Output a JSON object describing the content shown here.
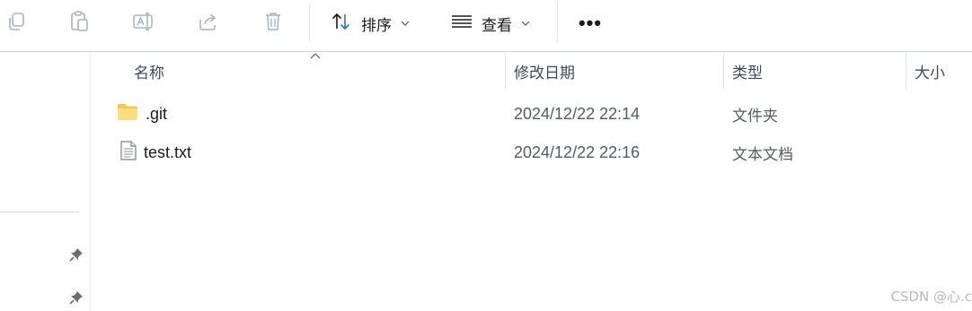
{
  "toolbar": {
    "icons": [
      "copy-icon",
      "paste-icon",
      "rename-icon",
      "share-icon",
      "delete-icon"
    ],
    "sort_label": "排序",
    "view_label": "查看",
    "more_label": "•••"
  },
  "columns": {
    "name": "名称",
    "date": "修改日期",
    "type": "类型",
    "size": "大小"
  },
  "files": [
    {
      "icon": "folder-icon",
      "name": ".git",
      "modified": "2024/12/22 22:14",
      "type": "文件夹"
    },
    {
      "icon": "text-file-icon",
      "name": "test.txt",
      "modified": "2024/12/22 22:16",
      "type": "文本文档"
    }
  ],
  "watermark": "CSDN @心.c",
  "colors": {
    "folder": "#f5c84c",
    "accent_blue": "#2f6fb3",
    "disabled_icon": "#a9b3c1",
    "header_text": "#3c4a5c"
  }
}
